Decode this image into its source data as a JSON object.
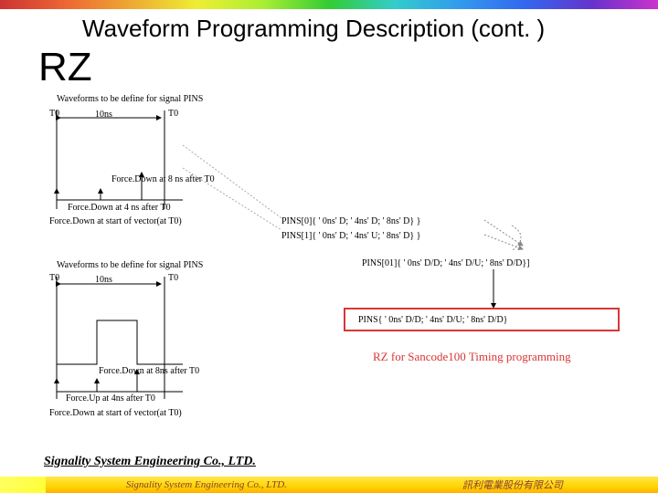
{
  "title": "Waveform Programming Description (cont. )",
  "heading": "RZ",
  "labels": {
    "wfDefine": "Waveforms to be define for signal PINS",
    "t0": "T0",
    "t10": "T0",
    "tenNs": "10ns",
    "fd8": "Force.Down at 8 ns after T0",
    "fd4": "Force.Down at 4 ns after T0",
    "fdStart": "Force.Down at start of vector(at T0)",
    "fd8b": "Force.Down at 8ns after T0",
    "fu4": "Force.Up at 4ns after T0",
    "fdStart2": "Force.Down at start of vector(at T0)"
  },
  "pins": {
    "p0": "PINS[0]{ ' 0ns' D; ' 4ns' D; ' 8ns' D} }",
    "p1": "PINS[1]{ ' 0ns' D; ' 4ns' U; ' 8ns' D} }",
    "p01": "PINS[01]{ ' 0ns' D/D; ' 4ns' D/U; ' 8ns' D/D}]",
    "boxed": "PINS{ ' 0ns' D/D; ' 4ns' D/U; ' 8ns' D/D}"
  },
  "redCaption": "RZ for Sancode100 Timing programming",
  "footer": {
    "lineEN": "Signality System Engineering Co., LTD.",
    "barEN": "Signality System Engineering Co., LTD.",
    "barZH": "訊利電業股份有限公司"
  }
}
